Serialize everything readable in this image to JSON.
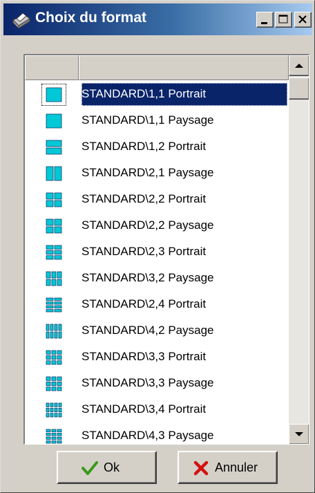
{
  "window": {
    "title": "Choix du format",
    "app_icon": "printer-icon"
  },
  "title_buttons": {
    "minimize": "minimize-icon",
    "maximize": "maximize-icon",
    "close": "close-icon"
  },
  "list": {
    "columns": [
      "",
      ""
    ],
    "selected_index": 0,
    "items": [
      {
        "label": "STANDARD\\1,1 Portrait",
        "layout": [
          1,
          1
        ]
      },
      {
        "label": "STANDARD\\1,1 Paysage",
        "layout": [
          1,
          1
        ]
      },
      {
        "label": "STANDARD\\1,2 Portrait",
        "layout": [
          1,
          2
        ]
      },
      {
        "label": "STANDARD\\2,1 Paysage",
        "layout": [
          2,
          1
        ]
      },
      {
        "label": "STANDARD\\2,2 Portrait",
        "layout": [
          2,
          2
        ]
      },
      {
        "label": "STANDARD\\2,2 Paysage",
        "layout": [
          2,
          2
        ]
      },
      {
        "label": "STANDARD\\2,3 Portrait",
        "layout": [
          2,
          3
        ]
      },
      {
        "label": "STANDARD\\3,2 Paysage",
        "layout": [
          3,
          2
        ]
      },
      {
        "label": "STANDARD\\2,4 Portrait",
        "layout": [
          2,
          4
        ]
      },
      {
        "label": "STANDARD\\4,2 Paysage",
        "layout": [
          4,
          2
        ]
      },
      {
        "label": "STANDARD\\3,3 Portrait",
        "layout": [
          3,
          3
        ]
      },
      {
        "label": "STANDARD\\3,3 Paysage",
        "layout": [
          3,
          3
        ]
      },
      {
        "label": "STANDARD\\3,4 Portrait",
        "layout": [
          4,
          3
        ]
      },
      {
        "label": "STANDARD\\4,3 Paysage",
        "layout": [
          3,
          4
        ]
      }
    ]
  },
  "buttons": {
    "ok": "Ok",
    "cancel": "Annuler"
  },
  "colors": {
    "accent": "#0a246a",
    "page_icon": "#00c8d6",
    "face": "#d4d0c8"
  }
}
